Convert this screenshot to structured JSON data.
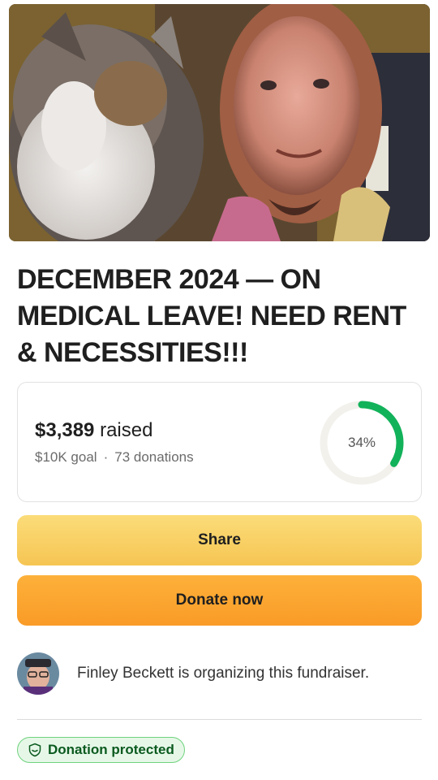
{
  "campaign": {
    "title": "DECEMBER 2024 — ON MEDICAL LEAVE! NEED RENT & NECESSITIES!!!",
    "hero_image": "selfie-with-cat"
  },
  "progress": {
    "raised_amount": "$3,389",
    "raised_suffix": "raised",
    "goal": "$10K goal",
    "separator": "·",
    "donations": "73 donations",
    "percent_label": "34%",
    "percent_value": 34
  },
  "actions": {
    "share_label": "Share",
    "donate_label": "Donate now"
  },
  "organizer": {
    "text": "Finley Beckett is organizing this fundraiser."
  },
  "badge": {
    "label": "Donation protected",
    "icon": "shield-icon"
  },
  "colors": {
    "progress_ring": "#12b25a",
    "ring_track": "#f2f1ec",
    "share_button": "#f8d066",
    "donate_button": "#fba533",
    "badge_border": "#6fd37d",
    "badge_text": "#0b5a1f"
  }
}
